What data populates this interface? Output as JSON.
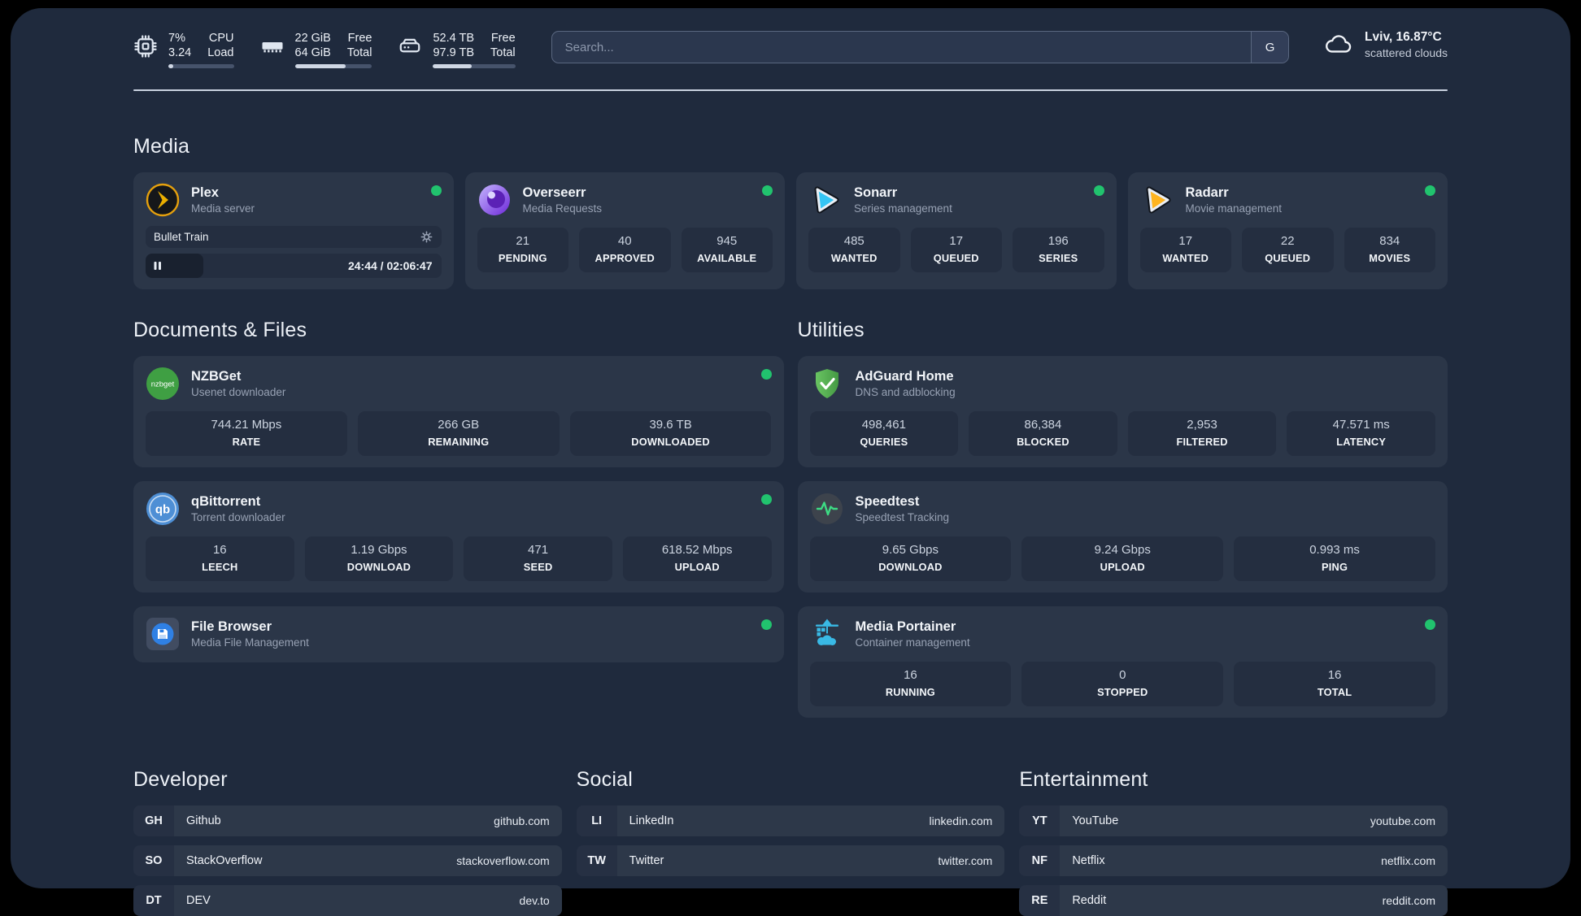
{
  "colors": {
    "status_green": "#21c36e",
    "plex_orange": "#e5a00d",
    "sonarr_blue": "#35c5f4",
    "radarr_yellow": "#ffb41f",
    "portainer_blue": "#39b9e5"
  },
  "header": {
    "system_stats": [
      {
        "name": "cpu",
        "value_line1": "7%",
        "value_line2": "3.24",
        "label_line1": "CPU",
        "label_line2": "Load",
        "progress_pct": 7
      },
      {
        "name": "memory",
        "value_line1": "22 GiB",
        "value_line2": "64 GiB",
        "label_line1": "Free",
        "label_line2": "Total",
        "progress_pct": 66
      },
      {
        "name": "disk",
        "value_line1": "52.4 TB",
        "value_line2": "97.9 TB",
        "label_line1": "Free",
        "label_line2": "Total",
        "progress_pct": 46.5
      }
    ],
    "search": {
      "placeholder": "Search...",
      "button_label": "G"
    },
    "weather": {
      "location": "Lviv, 16.87°C",
      "condition": "scattered clouds"
    }
  },
  "media": {
    "section_title": "Media",
    "plex": {
      "title": "Plex",
      "subtitle": "Media server",
      "now_playing": "Bullet Train",
      "time_display": "24:44 / 02:06:47",
      "progress_pct": 19.5
    },
    "overseerr": {
      "title": "Overseerr",
      "subtitle": "Media Requests",
      "stats": [
        {
          "value": "21",
          "label": "PENDING"
        },
        {
          "value": "40",
          "label": "APPROVED"
        },
        {
          "value": "945",
          "label": "AVAILABLE"
        }
      ]
    },
    "sonarr": {
      "title": "Sonarr",
      "subtitle": "Series management",
      "stats": [
        {
          "value": "485",
          "label": "WANTED"
        },
        {
          "value": "17",
          "label": "QUEUED"
        },
        {
          "value": "196",
          "label": "SERIES"
        }
      ]
    },
    "radarr": {
      "title": "Radarr",
      "subtitle": "Movie management",
      "stats": [
        {
          "value": "17",
          "label": "WANTED"
        },
        {
          "value": "22",
          "label": "QUEUED"
        },
        {
          "value": "834",
          "label": "MOVIES"
        }
      ]
    }
  },
  "documents": {
    "section_title": "Documents & Files",
    "nzbget": {
      "title": "NZBGet",
      "subtitle": "Usenet downloader",
      "stats": [
        {
          "value": "744.21 Mbps",
          "label": "RATE"
        },
        {
          "value": "266 GB",
          "label": "REMAINING"
        },
        {
          "value": "39.6 TB",
          "label": "DOWNLOADED"
        }
      ]
    },
    "qbittorrent": {
      "title": "qBittorrent",
      "subtitle": "Torrent downloader",
      "stats": [
        {
          "value": "16",
          "label": "LEECH"
        },
        {
          "value": "1.19 Gbps",
          "label": "DOWNLOAD"
        },
        {
          "value": "471",
          "label": "SEED"
        },
        {
          "value": "618.52 Mbps",
          "label": "UPLOAD"
        }
      ]
    },
    "filebrowser": {
      "title": "File Browser",
      "subtitle": "Media File Management"
    }
  },
  "utilities": {
    "section_title": "Utilities",
    "adguard": {
      "title": "AdGuard Home",
      "subtitle": "DNS and adblocking",
      "stats": [
        {
          "value": "498,461",
          "label": "QUERIES"
        },
        {
          "value": "86,384",
          "label": "BLOCKED"
        },
        {
          "value": "2,953",
          "label": "FILTERED"
        },
        {
          "value": "47.571 ms",
          "label": "LATENCY"
        }
      ]
    },
    "speedtest": {
      "title": "Speedtest",
      "subtitle": "Speedtest Tracking",
      "stats": [
        {
          "value": "9.65 Gbps",
          "label": "DOWNLOAD"
        },
        {
          "value": "9.24 Gbps",
          "label": "UPLOAD"
        },
        {
          "value": "0.993 ms",
          "label": "PING"
        }
      ]
    },
    "portainer": {
      "title": "Media Portainer",
      "subtitle": "Container management",
      "stats": [
        {
          "value": "16",
          "label": "RUNNING"
        },
        {
          "value": "0",
          "label": "STOPPED"
        },
        {
          "value": "16",
          "label": "TOTAL"
        }
      ]
    }
  },
  "bookmarks": [
    {
      "section_title": "Developer",
      "links": [
        {
          "abbr": "GH",
          "name": "Github",
          "url": "github.com"
        },
        {
          "abbr": "SO",
          "name": "StackOverflow",
          "url": "stackoverflow.com"
        },
        {
          "abbr": "DT",
          "name": "DEV",
          "url": "dev.to"
        }
      ]
    },
    {
      "section_title": "Social",
      "links": [
        {
          "abbr": "LI",
          "name": "LinkedIn",
          "url": "linkedin.com"
        },
        {
          "abbr": "TW",
          "name": "Twitter",
          "url": "twitter.com"
        }
      ]
    },
    {
      "section_title": "Entertainment",
      "links": [
        {
          "abbr": "YT",
          "name": "YouTube",
          "url": "youtube.com"
        },
        {
          "abbr": "NF",
          "name": "Netflix",
          "url": "netflix.com"
        },
        {
          "abbr": "RE",
          "name": "Reddit",
          "url": "reddit.com"
        }
      ]
    }
  ],
  "icon_labels": {
    "nzbget": "nzbget",
    "qbittorrent": "qb"
  }
}
